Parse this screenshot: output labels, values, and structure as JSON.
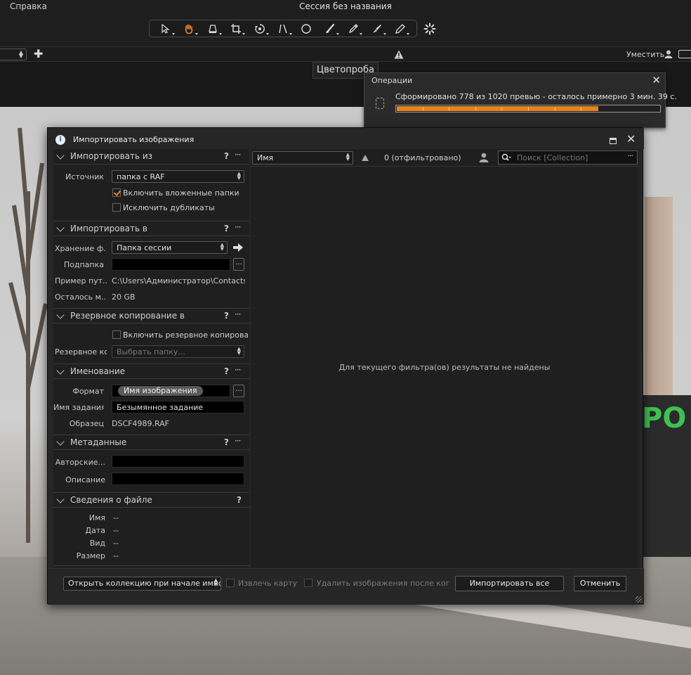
{
  "app": {
    "menu_help": "Справка",
    "session_title": "Сессия без названия",
    "fit_label": "Уместить",
    "color_tab": "Цветопроба"
  },
  "toolbar": {
    "tools": [
      "cursor-icon",
      "hand-icon",
      "keystone-icon",
      "crop-icon",
      "rotate-icon",
      "straighten-icon",
      "circle-icon",
      "brush-icon",
      "picker-icon",
      "eraser-icon",
      "pen-icon"
    ],
    "active_tool": "hand-icon",
    "accent_color": "#f08a24"
  },
  "operations": {
    "title": "Операции",
    "status": "Сформировано 778 из 1020 превью - осталось примерно 3 мин. 39 с.",
    "done": 778,
    "total": 1020,
    "progress_color": "#e8821e"
  },
  "dialog": {
    "title": "Импортировать изображения",
    "import_from": {
      "title": "Импортировать из",
      "source_label": "Источник",
      "source_value": "папка с RAF",
      "include_subfolders": "Включить вложенные папки",
      "include_subfolders_checked": true,
      "exclude_duplicates": "Исключить дубликаты",
      "exclude_duplicates_checked": false
    },
    "import_to": {
      "title": "Импортировать в",
      "storage_label": "Хранение ф...",
      "storage_value": "Папка сессии",
      "subfolder_label": "Подпапка",
      "subfolder_value": "",
      "browse": "...",
      "path_example_label": "Пример пут...",
      "path_example_value": "C:\\Users\\Администратор\\Contacts\\...",
      "remaining_label": "Осталось м...",
      "remaining_value": "20 GB"
    },
    "backup": {
      "title": "Резервное копирование в",
      "enable": "Включить резервное копировани",
      "enable_checked": false,
      "location_label": "Резервное ко",
      "location_placeholder": "Выбрать папку..."
    },
    "naming": {
      "title": "Именование",
      "format_label": "Формат",
      "format_token": "Имя изображения",
      "browse": "...",
      "job_label": "Имя задания",
      "job_value": "Безымянное задание",
      "sample_label": "Образец",
      "sample_value": "DSCF4989.RAF"
    },
    "metadata": {
      "title": "Метаданные",
      "copyright_label": "Авторские...",
      "copyright_value": "",
      "description_label": "Описание",
      "description_value": ""
    },
    "file_info": {
      "title": "Сведения о файле",
      "rows": [
        {
          "label": "Имя",
          "value": "--"
        },
        {
          "label": "Дата",
          "value": "--"
        },
        {
          "label": "Вид",
          "value": "--"
        },
        {
          "label": "Размер",
          "value": "--"
        }
      ]
    },
    "section_help": "?",
    "section_more": "···",
    "browser": {
      "sort_value": "Имя",
      "filtered_text": "0 (отфильтровано)",
      "search_placeholder": "Поиск [Collection]",
      "empty_message": "Для текущего фильтра(ов) результаты не найдены"
    },
    "footer": {
      "open_collection": "Открыть коллекцию при начале импорт",
      "eject_card": "Извлечь карту",
      "delete_after": "Удалить изображения после копиров",
      "import_all": "Импортировать все",
      "cancel": "Отменить"
    }
  }
}
